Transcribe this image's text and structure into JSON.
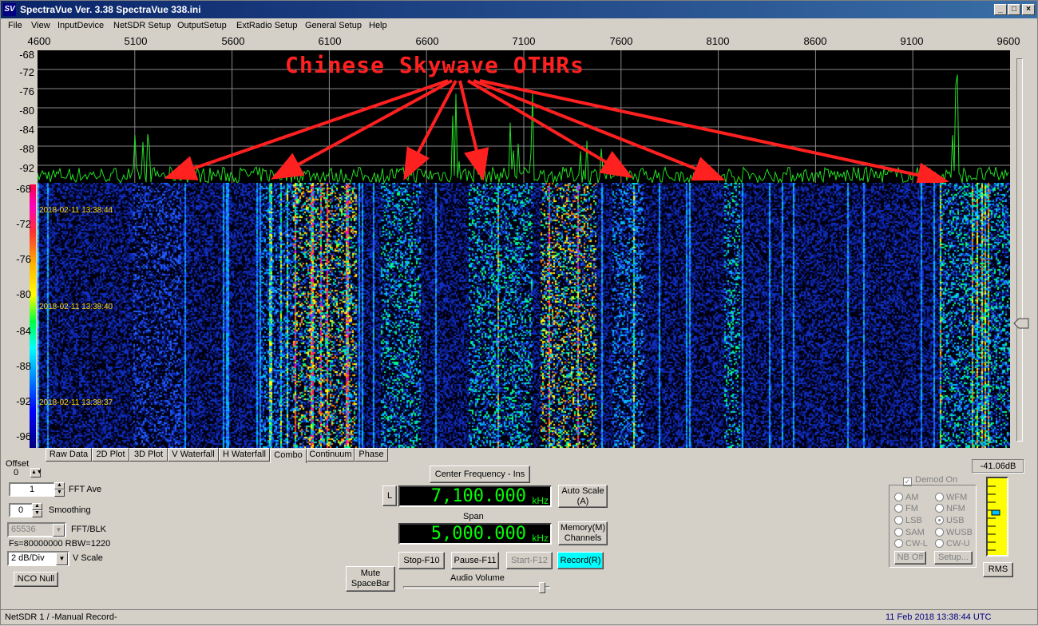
{
  "window": {
    "title": "SpectraVue Ver. 3.38  SpectraVue 338.ini",
    "icon": "SV"
  },
  "menu": [
    "File",
    "View",
    "InputDevice",
    "NetSDR Setup",
    "OutputSetup",
    "ExtRadio Setup",
    "General Setup",
    "Help"
  ],
  "freq_axis": [
    "4600",
    "5100",
    "5600",
    "6100",
    "6600",
    "7100",
    "7600",
    "8100",
    "8600",
    "9100",
    "9600"
  ],
  "spectrum_y": [
    "-68",
    "-72",
    "-76",
    "-80",
    "-84",
    "-88",
    "-92"
  ],
  "waterfall_y": [
    "-68",
    "-72",
    "-76",
    "-80",
    "-84",
    "-88",
    "-92",
    "-96"
  ],
  "timestamps": [
    "2018-02-11 13:38:44",
    "2018-02-11 13:38:40",
    "2018-02-11 13:38:37"
  ],
  "annotation": "Chinese Skywave OTHRs",
  "tabs": [
    "Raw Data",
    "2D Plot",
    "3D Plot",
    "V Waterfall",
    "H Waterfall",
    "Combo",
    "Continuum",
    "Phase"
  ],
  "active_tab": "Combo",
  "left": {
    "offset_label": "Offset",
    "offset_value": "0",
    "fft_ave_value": "1",
    "fft_ave_label": "FFT Ave",
    "smoothing_value": "0",
    "smoothing_label": "Smoothing",
    "fft_blk_value": "65536",
    "fft_blk_label": "FFT/BLK",
    "fs_text": "Fs=80000000 RBW=1220",
    "vscale_value": "2 dB/Div",
    "vscale_label": "V Scale",
    "nco_null": "NCO Null"
  },
  "center": {
    "center_freq_btn": "Center Frequency - Ins",
    "l_btn": "L",
    "center_value": "7,100.000",
    "unit": "kHz",
    "span_label": "Span",
    "span_value": "5,000.000",
    "auto_scale_1": "Auto Scale",
    "auto_scale_2": "(A)",
    "memory_1": "Memory(M)",
    "memory_2": "Channels",
    "mute_1": "Mute",
    "mute_2": "SpaceBar",
    "stop": "Stop-F10",
    "pause": "Pause-F11",
    "start": "Start-F12",
    "record": "Record(R)",
    "audio_volume": "Audio Volume"
  },
  "demod": {
    "title": "Demod On",
    "left_col": [
      "AM",
      "FM",
      "LSB",
      "SAM",
      "CW-L"
    ],
    "right_col": [
      "WFM",
      "NFM",
      "USB",
      "WUSB",
      "CW-U"
    ],
    "selected": "USB",
    "nb_off": "NB Off",
    "setup": "Setup..."
  },
  "meter": {
    "value": "-41.06dB",
    "rms": "RMS"
  },
  "status": {
    "left": "NetSDR 1  / -Manual Record-",
    "right": "11 Feb 2018  13:38:44 UTC"
  },
  "colors": {
    "trace": "#22e022",
    "annotation": "#ff2020",
    "lcd": "#00ff00",
    "title_bar": "#0a246a"
  }
}
